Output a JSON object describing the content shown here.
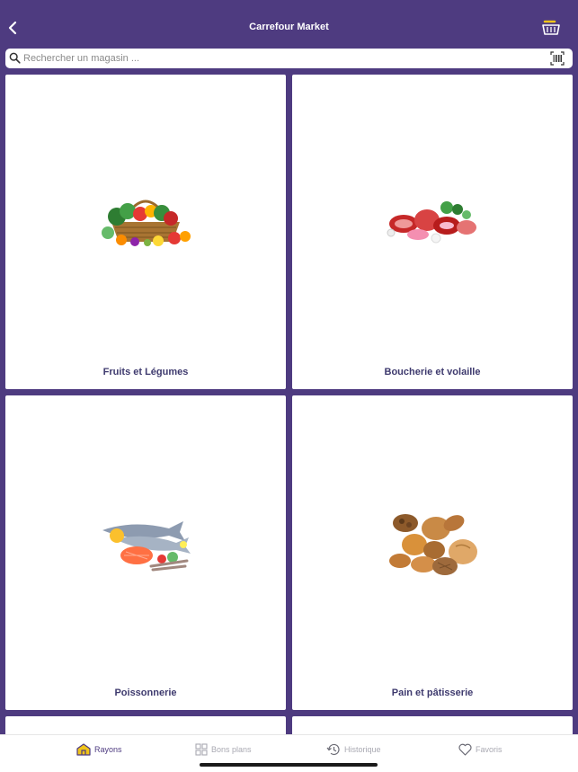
{
  "header": {
    "title": "Carrefour Market",
    "back_icon": "chevron-left-icon",
    "basket_icon": "basket-icon"
  },
  "search": {
    "placeholder": "Rechercher un magasin ...",
    "value": "",
    "search_icon": "search-icon",
    "scan_icon": "barcode-scan-icon"
  },
  "categories": [
    {
      "label": "Fruits et Légumes",
      "image": "fruits-vegetables-basket"
    },
    {
      "label": "Boucherie et volaille",
      "image": "raw-meat-cuts"
    },
    {
      "label": "Poissonnerie",
      "image": "fish-seafood"
    },
    {
      "label": "Pain et pâtisserie",
      "image": "bread-pastries"
    }
  ],
  "tabbar": {
    "items": [
      {
        "label": "Rayons",
        "icon": "store-icon",
        "active": true
      },
      {
        "label": "Bons plans",
        "icon": "grid-icon",
        "active": false
      },
      {
        "label": "Historique",
        "icon": "history-icon",
        "active": false
      },
      {
        "label": "Favoris",
        "icon": "heart-icon",
        "active": false
      }
    ]
  },
  "colors": {
    "primary": "#4e3b80",
    "label": "#3e3a6e",
    "inactive_tab": "#a9a9b2"
  }
}
